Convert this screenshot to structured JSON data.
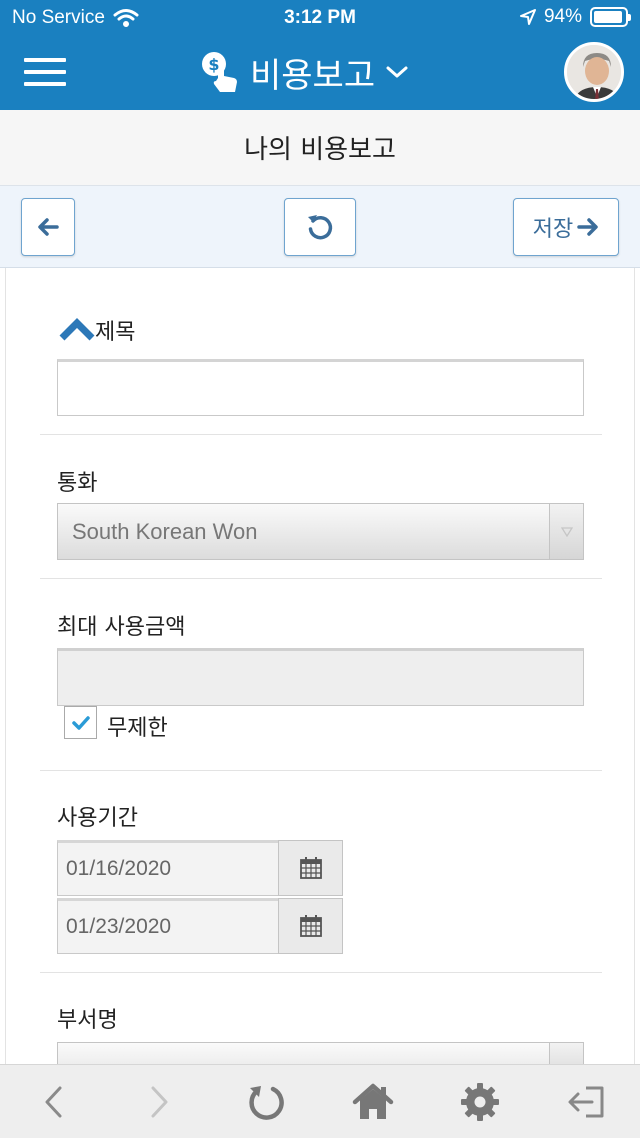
{
  "status_bar": {
    "carrier": "No Service",
    "time": "3:12 PM",
    "battery": "94%",
    "battery_level": 0.94
  },
  "header": {
    "title": "비용보고",
    "menu_icon": "hamburger-icon",
    "app_icon": "money-hand-icon",
    "dropdown_icon": "chevron-down-icon"
  },
  "page": {
    "title": "나의 비용보고"
  },
  "toolbar": {
    "back_icon": "arrow-left-icon",
    "refresh_icon": "refresh-icon",
    "save_label": "저장"
  },
  "form": {
    "title_label": "제목",
    "title_value": "",
    "currency_label": "통화",
    "currency_value": "South Korean Won",
    "max_amount_label": "최대 사용금액",
    "max_amount_value": "",
    "unlimited_label": "무제한",
    "unlimited_checked": true,
    "period_label": "사용기간",
    "start_date": "01/16/2020",
    "end_date": "01/23/2020",
    "dept_label": "부서명"
  },
  "bottom_nav": {
    "items": [
      "back-icon",
      "forward-icon",
      "reload-icon",
      "home-icon",
      "settings-icon",
      "logout-icon"
    ]
  },
  "colors": {
    "header_blue": "#1a80c0",
    "accent_blue": "#3b6d9a",
    "check_blue": "#2a9bd6"
  }
}
